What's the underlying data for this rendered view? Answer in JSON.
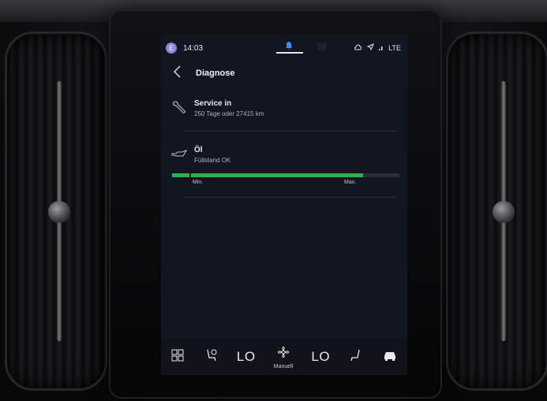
{
  "status": {
    "profile_initial": "E",
    "time": "14:03",
    "network": "LTE"
  },
  "header": {
    "title": "Diagnose"
  },
  "items": [
    {
      "label": "Service in",
      "detail": "250 Tage oder 27415 km"
    },
    {
      "label": "Öl",
      "detail": "Füllstand OK"
    }
  ],
  "oil_level": {
    "fraction": 0.84,
    "min_label": "Min.",
    "max_label": "Max.",
    "color": "#2bb24c"
  },
  "climate": {
    "left_temp": "LO",
    "right_temp": "LO",
    "fan_mode": "Manuell",
    "icons": [
      "app-grid-icon",
      "seat-heat-left-icon",
      "fan-icon",
      "seat-heat-right-icon",
      "car-icon"
    ]
  }
}
